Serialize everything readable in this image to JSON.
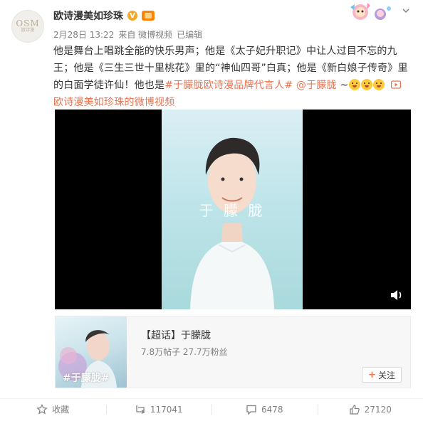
{
  "post": {
    "author": {
      "name": "欧诗漫美如珍珠",
      "avatar_text": "OSM",
      "avatar_subtext": "欧诗漫",
      "verified_icon": "verified-badge-icon",
      "member_icon": "member-crown-icon"
    },
    "meta": {
      "date": "2月28日 13:22",
      "source": "来自 微博视频",
      "edited": "已编辑"
    },
    "content": {
      "part1": "他是舞台上唱跳全能的快乐男声；他是《太子妃升职记》中让人过目不忘的九王；他是《三生三世十里桃花》里的“神仙四哥”白真；他是《新白娘子传奇》里的白面学徒许仙！他也是",
      "hashtag": "#于朦胧欧诗漫品牌代言人#",
      "space": " ",
      "mention": "@于朦胧",
      "tilde": " ~",
      "link_icon": "video-link-icon",
      "link_text": "欧诗漫美如珍珠的微博视频"
    },
    "video": {
      "watermark": "于 朦 胧",
      "speaker_icon": "speaker-icon"
    },
    "card": {
      "thumb_tag": "#于朦胧#",
      "title": "【超话】于朦胧",
      "stats": "7.8万帖子 27.7万粉丝",
      "follow_label": "关注"
    },
    "actions": {
      "favorite_label": "收藏",
      "repost_count": "117041",
      "comment_count": "6478",
      "like_count": "27120"
    },
    "colors": {
      "link": "#eb7350",
      "secondary_text": "#808080",
      "video_bg": "#000000"
    }
  }
}
